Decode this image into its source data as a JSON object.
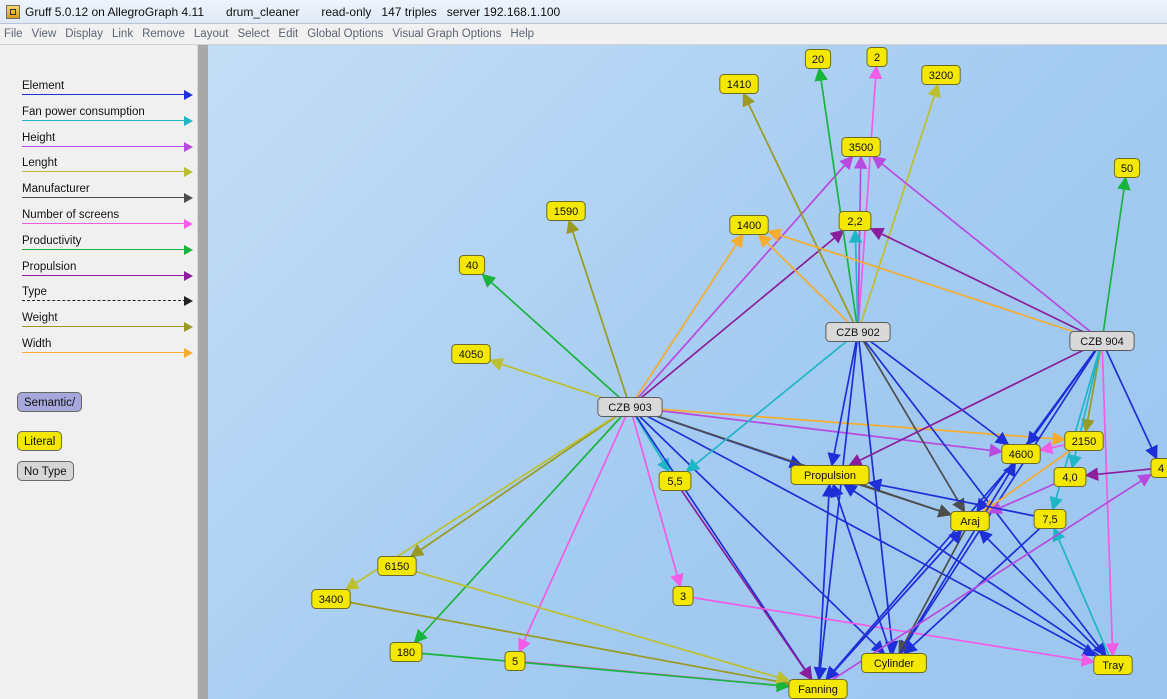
{
  "window": {
    "title": "Gruff 5.0.12 on AllegroGraph 4.11",
    "store": "drum_cleaner",
    "mode": "read-only",
    "triples": "147 triples",
    "server": "server 192.168.1.100"
  },
  "menu": [
    "File",
    "View",
    "Display",
    "Link",
    "Remove",
    "Layout",
    "Select",
    "Edit",
    "Global Options",
    "Visual Graph Options",
    "Help"
  ],
  "legend": [
    {
      "label": "Element",
      "color": "#1e2fd8",
      "dashed": false
    },
    {
      "label": "Fan power consumption",
      "color": "#1fb6c6",
      "dashed": false
    },
    {
      "label": "Height",
      "color": "#b84ae0",
      "dashed": false
    },
    {
      "label": "Lenght",
      "color": "#bcc030",
      "dashed": false
    },
    {
      "label": "Manufacturer",
      "color": "#4d4d4d",
      "dashed": false
    },
    {
      "label": "Number of screens",
      "color": "#f25ce6",
      "dashed": false
    },
    {
      "label": "Productivity",
      "color": "#19b43c",
      "dashed": false
    },
    {
      "label": "Propulsion",
      "color": "#8a1e9c",
      "dashed": false
    },
    {
      "label": "Type",
      "color": "#222222",
      "dashed": true
    },
    {
      "label": "Weight",
      "color": "#9a9a22",
      "dashed": false
    },
    {
      "label": "Width",
      "color": "#f6ac2e",
      "dashed": false
    }
  ],
  "type_buttons": [
    {
      "label": "Semantic/",
      "color": "#a7a7dc"
    },
    {
      "label": "Literal",
      "color": "#f4e800"
    },
    {
      "label": "No Type",
      "color": "#d6d6d6"
    }
  ],
  "nodes": [
    {
      "id": "n20",
      "label": "20",
      "kind": "literal"
    },
    {
      "id": "n2",
      "label": "2",
      "kind": "literal"
    },
    {
      "id": "n1410",
      "label": "1410",
      "kind": "literal"
    },
    {
      "id": "n3200",
      "label": "3200",
      "kind": "literal"
    },
    {
      "id": "n3500",
      "label": "3500",
      "kind": "literal"
    },
    {
      "id": "n50",
      "label": "50",
      "kind": "literal"
    },
    {
      "id": "n1590",
      "label": "1590",
      "kind": "literal"
    },
    {
      "id": "n1400",
      "label": "1400",
      "kind": "literal"
    },
    {
      "id": "n22",
      "label": "2,2",
      "kind": "literal"
    },
    {
      "id": "n40",
      "label": "40",
      "kind": "literal"
    },
    {
      "id": "czb902",
      "label": "CZB 902",
      "kind": "semantic"
    },
    {
      "id": "czb904",
      "label": "CZB 904",
      "kind": "semantic"
    },
    {
      "id": "n4050",
      "label": "4050",
      "kind": "literal"
    },
    {
      "id": "czb903",
      "label": "CZB 903",
      "kind": "semantic"
    },
    {
      "id": "n4600",
      "label": "4600",
      "kind": "literal"
    },
    {
      "id": "n2150",
      "label": "2150",
      "kind": "literal"
    },
    {
      "id": "n55",
      "label": "5,5",
      "kind": "literal"
    },
    {
      "id": "propulsion",
      "label": "Propulsion",
      "kind": "literal"
    },
    {
      "id": "n40b",
      "label": "4,0",
      "kind": "literal"
    },
    {
      "id": "n4",
      "label": "4",
      "kind": "literal"
    },
    {
      "id": "araj",
      "label": "Araj",
      "kind": "literal"
    },
    {
      "id": "n75",
      "label": "7,5",
      "kind": "literal"
    },
    {
      "id": "n6150",
      "label": "6150",
      "kind": "literal"
    },
    {
      "id": "n3400",
      "label": "3400",
      "kind": "literal"
    },
    {
      "id": "n3",
      "label": "3",
      "kind": "literal"
    },
    {
      "id": "n180",
      "label": "180",
      "kind": "literal"
    },
    {
      "id": "n5",
      "label": "5",
      "kind": "literal"
    },
    {
      "id": "cylinder",
      "label": "Cylinder",
      "kind": "literal"
    },
    {
      "id": "tray",
      "label": "Tray",
      "kind": "literal"
    },
    {
      "id": "fanning",
      "label": "Fanning",
      "kind": "literal"
    }
  ],
  "edges": [
    {
      "from": "czb903",
      "to": "n40",
      "color": "#19b43c"
    },
    {
      "from": "czb903",
      "to": "n1590",
      "color": "#9a9a22"
    },
    {
      "from": "czb903",
      "to": "n4050",
      "color": "#bcc030"
    },
    {
      "from": "czb903",
      "to": "n1400",
      "color": "#f6ac2e"
    },
    {
      "from": "czb903",
      "to": "n22",
      "color": "#8a1e9c"
    },
    {
      "from": "czb903",
      "to": "n3500",
      "color": "#b84ae0"
    },
    {
      "from": "czb903",
      "to": "n6150",
      "color": "#9a9a22"
    },
    {
      "from": "czb903",
      "to": "n3400",
      "color": "#bcc030"
    },
    {
      "from": "czb903",
      "to": "n180",
      "color": "#19b43c"
    },
    {
      "from": "czb903",
      "to": "n5",
      "color": "#f25ce6"
    },
    {
      "from": "czb903",
      "to": "n3",
      "color": "#f25ce6"
    },
    {
      "from": "czb903",
      "to": "n55",
      "color": "#1fb6c6"
    },
    {
      "from": "czb903",
      "to": "propulsion",
      "color": "#1e2fd8"
    },
    {
      "from": "czb903",
      "to": "araj",
      "color": "#4d4d4d"
    },
    {
      "from": "czb903",
      "to": "n4600",
      "color": "#b84ae0"
    },
    {
      "from": "czb903",
      "to": "n2150",
      "color": "#f6ac2e"
    },
    {
      "from": "czb903",
      "to": "cylinder",
      "color": "#1e2fd8"
    },
    {
      "from": "czb903",
      "to": "fanning",
      "color": "#1e2fd8"
    },
    {
      "from": "czb903",
      "to": "tray",
      "color": "#1e2fd8"
    },
    {
      "from": "czb902",
      "to": "n1410",
      "color": "#9a9a22"
    },
    {
      "from": "czb902",
      "to": "n20",
      "color": "#19b43c"
    },
    {
      "from": "czb902",
      "to": "n2",
      "color": "#f25ce6"
    },
    {
      "from": "czb902",
      "to": "n3200",
      "color": "#bcc030"
    },
    {
      "from": "czb902",
      "to": "n3500",
      "color": "#b84ae0"
    },
    {
      "from": "czb902",
      "to": "n22",
      "color": "#1fb6c6"
    },
    {
      "from": "czb902",
      "to": "n1400",
      "color": "#f6ac2e"
    },
    {
      "from": "czb902",
      "to": "n55",
      "color": "#1fb6c6"
    },
    {
      "from": "czb902",
      "to": "propulsion",
      "color": "#1e2fd8"
    },
    {
      "from": "czb902",
      "to": "araj",
      "color": "#4d4d4d"
    },
    {
      "from": "czb902",
      "to": "n4600",
      "color": "#1e2fd8"
    },
    {
      "from": "czb902",
      "to": "cylinder",
      "color": "#1e2fd8"
    },
    {
      "from": "czb902",
      "to": "tray",
      "color": "#1e2fd8"
    },
    {
      "from": "czb902",
      "to": "fanning",
      "color": "#1e2fd8"
    },
    {
      "from": "czb904",
      "to": "n50",
      "color": "#19b43c"
    },
    {
      "from": "czb904",
      "to": "n3500",
      "color": "#b84ae0"
    },
    {
      "from": "czb904",
      "to": "n22",
      "color": "#8a1e9c"
    },
    {
      "from": "czb904",
      "to": "n1400",
      "color": "#f6ac2e"
    },
    {
      "from": "czb904",
      "to": "n4600",
      "color": "#1e2fd8"
    },
    {
      "from": "czb904",
      "to": "n2150",
      "color": "#9a9a22"
    },
    {
      "from": "czb904",
      "to": "n40b",
      "color": "#1fb6c6"
    },
    {
      "from": "czb904",
      "to": "araj",
      "color": "#1e2fd8"
    },
    {
      "from": "czb904",
      "to": "n75",
      "color": "#1fb6c6"
    },
    {
      "from": "czb904",
      "to": "tray",
      "color": "#f25ce6"
    },
    {
      "from": "czb904",
      "to": "cylinder",
      "color": "#1e2fd8"
    },
    {
      "from": "czb904",
      "to": "n4",
      "color": "#1e2fd8"
    },
    {
      "from": "czb904",
      "to": "propulsion",
      "color": "#8a1e9c"
    },
    {
      "from": "propulsion",
      "to": "araj",
      "color": "#4d4d4d"
    },
    {
      "from": "n55",
      "to": "fanning",
      "color": "#8a1e9c"
    },
    {
      "from": "n3",
      "to": "tray",
      "color": "#f25ce6"
    },
    {
      "from": "n5",
      "to": "fanning",
      "color": "#f25ce6"
    },
    {
      "from": "n3400",
      "to": "fanning",
      "color": "#9a9a22"
    },
    {
      "from": "n180",
      "to": "fanning",
      "color": "#19b43c"
    },
    {
      "from": "n6150",
      "to": "fanning",
      "color": "#bcc030"
    },
    {
      "from": "araj",
      "to": "cylinder",
      "color": "#4d4d4d"
    },
    {
      "from": "araj",
      "to": "fanning",
      "color": "#b84ae0"
    },
    {
      "from": "n4600",
      "to": "fanning",
      "color": "#1e2fd8"
    },
    {
      "from": "n2150",
      "to": "araj",
      "color": "#f6ac2e"
    },
    {
      "from": "n40b",
      "to": "araj",
      "color": "#b84ae0"
    },
    {
      "from": "n75",
      "to": "cylinder",
      "color": "#1e2fd8"
    },
    {
      "from": "n4",
      "to": "n40b",
      "color": "#8a1e9c"
    },
    {
      "from": "n2150",
      "to": "n4600",
      "color": "#f25ce6"
    },
    {
      "from": "tray",
      "to": "n75",
      "color": "#1fb6c6"
    },
    {
      "from": "cylinder",
      "to": "propulsion",
      "color": "#1e2fd8"
    },
    {
      "from": "fanning",
      "to": "propulsion",
      "color": "#1e2fd8"
    },
    {
      "from": "tray",
      "to": "propulsion",
      "color": "#1e2fd8"
    },
    {
      "from": "fanning",
      "to": "araj",
      "color": "#1e2fd8"
    },
    {
      "from": "tray",
      "to": "araj",
      "color": "#1e2fd8"
    },
    {
      "from": "cylinder",
      "to": "n4600",
      "color": "#1e2fd8"
    },
    {
      "from": "fanning",
      "to": "n4",
      "color": "#b84ae0"
    },
    {
      "from": "n75",
      "to": "propulsion",
      "color": "#1e2fd8"
    }
  ]
}
